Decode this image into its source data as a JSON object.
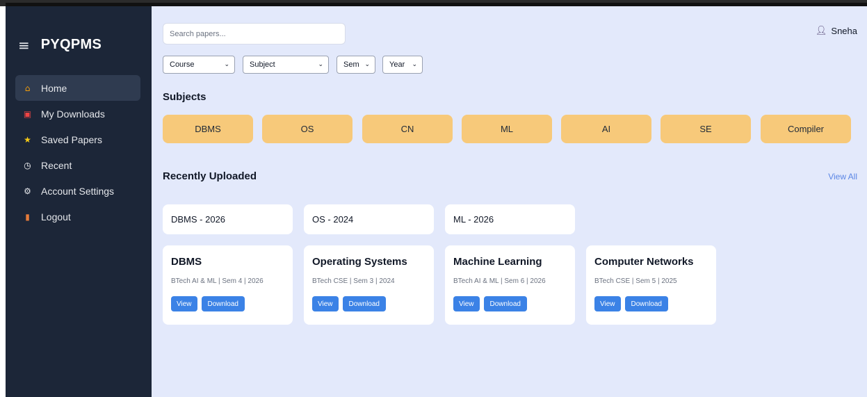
{
  "app": {
    "title": "PYQPMS",
    "menu_icon": "hamburger-icon"
  },
  "sidebar": {
    "items": [
      {
        "label": "Home",
        "icon": "house-icon",
        "glyph": "⌂",
        "color": "#f59e0b",
        "active": true
      },
      {
        "label": "My Downloads",
        "icon": "download-box-icon",
        "glyph": "▣",
        "color": "#ef4444",
        "active": false
      },
      {
        "label": "Saved Papers",
        "icon": "star-icon",
        "glyph": "★",
        "color": "#facc15",
        "active": false
      },
      {
        "label": "Recent",
        "icon": "clock-icon",
        "glyph": "◷",
        "color": "#ffffff",
        "active": false
      },
      {
        "label": "Account Settings",
        "icon": "gear-icon",
        "glyph": "⚙",
        "color": "#e5e7eb",
        "active": false
      },
      {
        "label": "Logout",
        "icon": "door-icon",
        "glyph": "▮",
        "color": "#e57b3a",
        "active": false
      }
    ]
  },
  "user": {
    "name": "Sneha",
    "icon": "user-icon"
  },
  "search": {
    "placeholder": "Search papers..."
  },
  "filters": {
    "course": "Course",
    "subject": "Subject",
    "sem": "Sem",
    "year": "Year"
  },
  "subjects": {
    "title": "Subjects",
    "items": [
      "DBMS",
      "OS",
      "CN",
      "ML",
      "AI",
      "SE",
      "Compiler"
    ]
  },
  "recent": {
    "title": "Recently Uploaded",
    "view_all": "View All",
    "quick": [
      "DBMS - 2026",
      "OS - 2024",
      "ML - 2026"
    ],
    "papers": [
      {
        "title": "DBMS",
        "meta": "BTech AI & ML | Sem 4 | 2026"
      },
      {
        "title": "Operating Systems",
        "meta": "BTech CSE | Sem 3 | 2024"
      },
      {
        "title": "Machine Learning",
        "meta": "BTech AI & ML | Sem 6 | 2026"
      },
      {
        "title": "Computer Networks",
        "meta": "BTech CSE | Sem 5 | 2025"
      }
    ],
    "view_label": "View",
    "download_label": "Download"
  },
  "colors": {
    "sidebar": "#1c2638",
    "background": "#e3e9fb",
    "subject_chip": "#f7c97a",
    "button": "#3b82e6",
    "link": "#5b86e5"
  }
}
